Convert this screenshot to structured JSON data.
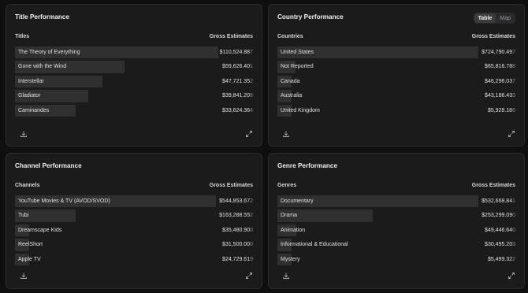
{
  "title_card": {
    "title": "Title Performance",
    "col1": "Titles",
    "col2": "Gross Estimates",
    "rows": [
      {
        "label": "The Theory of Everything",
        "value": "$110,524.88",
        "last": "7",
        "share": 1.0
      },
      {
        "label": "Gone with the Wind",
        "value": "$59,626.40",
        "last": "1",
        "share": 0.54
      },
      {
        "label": "Interstellar",
        "value": "$47,721.35",
        "last": "2",
        "share": 0.43
      },
      {
        "label": "Gladiator",
        "value": "$39,841.20",
        "last": "8",
        "share": 0.36
      },
      {
        "label": "Caminandes",
        "value": "$33,624.36",
        "last": "4",
        "share": 0.3
      }
    ]
  },
  "country_card": {
    "title": "Country Performance",
    "col1": "Countries",
    "col2": "Gross Estimates",
    "toggle": {
      "table": "Table",
      "map": "Map"
    },
    "rows": [
      {
        "label": "United States",
        "value": "$724,790.49",
        "last": "7",
        "share": 1.0
      },
      {
        "label": "Not Reported",
        "value": "$65,816.78",
        "last": "8",
        "share": 0.09
      },
      {
        "label": "Canada",
        "value": "$46,296.03",
        "last": "7",
        "share": 0.065
      },
      {
        "label": "Australia",
        "value": "$43,186.43",
        "last": "3",
        "share": 0.06
      },
      {
        "label": "United Kingdom",
        "value": "$5,928.18",
        "last": "6",
        "share": 0.008
      }
    ]
  },
  "channel_card": {
    "title": "Channel Performance",
    "col1": "Channels",
    "col2": "Gross Estimates",
    "rows": [
      {
        "label": "YouTube Movies & TV (AVOD/SVOD)",
        "value": "$544,853.67",
        "last": "2",
        "share": 1.0
      },
      {
        "label": "Tubi",
        "value": "$163,288.55",
        "last": "2",
        "share": 0.3
      },
      {
        "label": "Dreamscape Kids",
        "value": "$35,480.90",
        "last": "0",
        "share": 0.065
      },
      {
        "label": "ReelShort",
        "value": "$31,500.00",
        "last": "0",
        "share": 0.058
      },
      {
        "label": "Apple TV",
        "value": "$24,729.61",
        "last": "9",
        "share": 0.045
      }
    ]
  },
  "genre_card": {
    "title": "Genre Performance",
    "col1": "Genres",
    "col2": "Gross Estimates",
    "rows": [
      {
        "label": "Documentary",
        "value": "$532,668.84",
        "last": "1",
        "share": 1.0
      },
      {
        "label": "Drama",
        "value": "$253,299.09",
        "last": "0",
        "share": 0.475
      },
      {
        "label": "Animation",
        "value": "$49,446.64",
        "last": "0",
        "share": 0.093
      },
      {
        "label": "Informational & Educational",
        "value": "$30,495.20",
        "last": "3",
        "share": 0.057
      },
      {
        "label": "Mystery",
        "value": "$5,499.32",
        "last": "2",
        "share": 0.01
      }
    ]
  },
  "icons": {
    "download": "download-icon",
    "expand": "expand-icon"
  }
}
